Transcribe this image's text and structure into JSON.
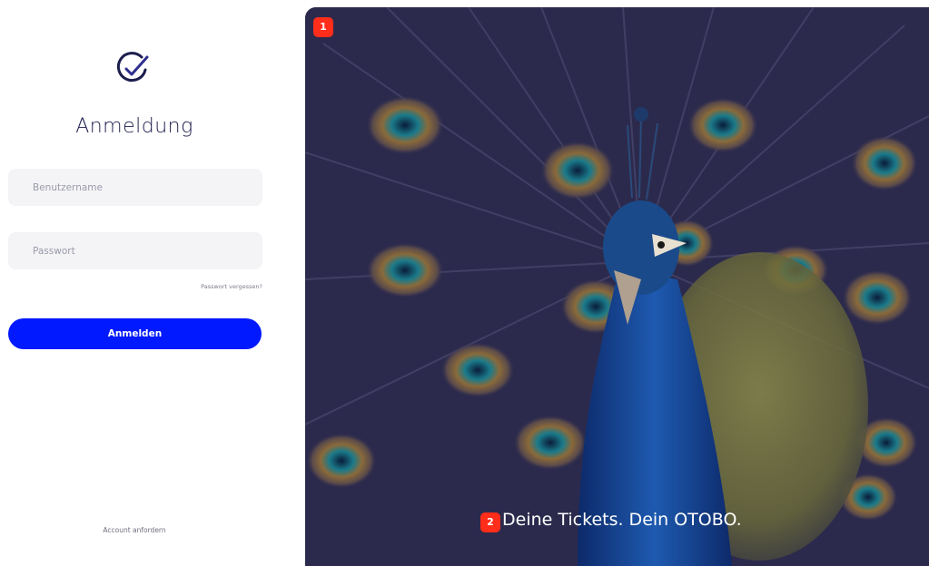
{
  "login": {
    "logo_icon": "check-circle-icon",
    "title": "Anmeldung",
    "username_placeholder": "Benutzername",
    "password_placeholder": "Passwort",
    "forgot_password": "Passwort vergessen?",
    "submit_label": "Anmelden",
    "request_account": "Account anfordern"
  },
  "hero": {
    "image_icon": "peacock-image",
    "badge_1": "1",
    "badge_2": "2",
    "tagline": "Deine Tickets. Dein OTOBO."
  },
  "colors": {
    "accent": "#0019ff",
    "title_text": "#1b1d4d",
    "field_bg": "#f4f4f7",
    "badge": "#ff2d1a"
  }
}
